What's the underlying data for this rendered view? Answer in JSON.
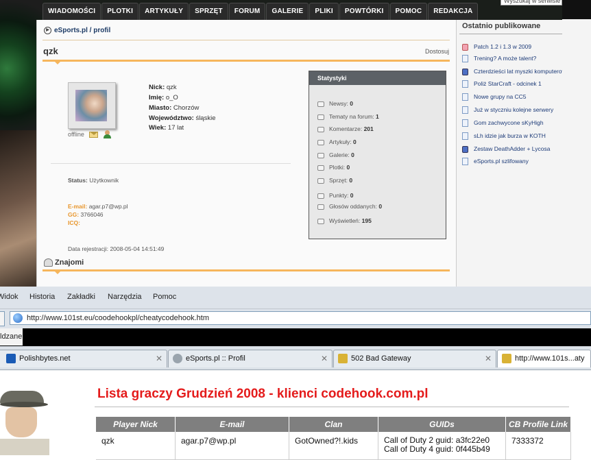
{
  "esports": {
    "nav_tabs": [
      "WIADOMOŚCI",
      "PLOTKI",
      "ARTYKUŁY",
      "SPRZĘT",
      "FORUM",
      "GALERIE",
      "PLIKI",
      "POWTÓRKI",
      "POMOC",
      "REDAKCJA"
    ],
    "search_placeholder": "Wyszukaj w serwisie",
    "breadcrumb": "eSports.pl / profil",
    "profile_title": "qzk",
    "customize_link": "Dostosuj",
    "offline": "offline",
    "fields": {
      "nick_label": "Nick:",
      "nick": "qzk",
      "imie_label": "Imię:",
      "imie": "o_O",
      "miasto_label": "Miasto:",
      "miasto": "Chorzów",
      "woj_label": "Województwo:",
      "woj": "śląskie",
      "wiek_label": "Wiek:",
      "wiek": "17 lat"
    },
    "status_label": "Status:",
    "status": "Użytkownik",
    "email_label": "E-mail:",
    "email": "agar.p7@wp.pl",
    "gg_label": "GG:",
    "gg": "3766046",
    "icq_label": "ICQ:",
    "reg_label": "Data rejestracji:",
    "reg_date": "2008-05-04 14:51:49",
    "friends": "Znajomi",
    "stats_title": "Statystyki",
    "stats": [
      {
        "label": "Newsy:",
        "value": "0"
      },
      {
        "label": "Tematy na forum:",
        "value": "1"
      },
      {
        "label": "Komentarze:",
        "value": "201"
      },
      {
        "label": "Artykuły:",
        "value": "0"
      },
      {
        "label": "Galerie:",
        "value": "0"
      },
      {
        "label": "Plotki:",
        "value": "0"
      },
      {
        "label": "Sprzęt:",
        "value": "0"
      },
      {
        "label": "Punkty:",
        "value": "0"
      },
      {
        "label": "Głosów oddanych:",
        "value": "0"
      },
      {
        "label": "Wyświetleń:",
        "value": "195"
      }
    ],
    "sidebar_title": "Ostatnio publikowane",
    "sidebar_items": [
      {
        "text": "Patch 1.2 i 1.3 w 2009",
        "icon": "red"
      },
      {
        "text": "Trening? A może talent?",
        "icon": "doc"
      },
      {
        "text": "Czterdzieści lat myszki komputerowej",
        "icon": "blue"
      },
      {
        "text": "Poliż StarCraft - odcinek 1",
        "icon": "doc"
      },
      {
        "text": "Nowe grupy na CC5",
        "icon": "doc"
      },
      {
        "text": "Już w styczniu kolejne serwery",
        "icon": "doc"
      },
      {
        "text": "Gom zachwycone sKyHigh",
        "icon": "doc"
      },
      {
        "text": "sLh idzie jak burza w KOTH",
        "icon": "doc"
      },
      {
        "text": "Zestaw DeathAdder + Lycosa",
        "icon": "blue"
      },
      {
        "text": "eSports.pl szlifowany",
        "icon": "doc"
      }
    ]
  },
  "browser": {
    "menu": [
      "Widok",
      "Historia",
      "Zakładki",
      "Narzędzia",
      "Pomoc"
    ],
    "url": "http://www.101st.eu/coodehookpl/cheatycodehook.htm",
    "bookmark_label": "ldzane",
    "tabs": [
      {
        "title": "Polishbytes.net",
        "fav_color": "#1a5bb5"
      },
      {
        "title": "eSports.pl :: Profil",
        "fav_color": "#9aa4ad"
      },
      {
        "title": "502 Bad Gateway",
        "fav_color": "#d9b235"
      },
      {
        "title": "http://www.101s...aty",
        "fav_color": "#d9b235"
      }
    ]
  },
  "page2": {
    "heading": "Lista graczy Grudzień 2008 - klienci codehook.com.pl",
    "columns": [
      "Player Nick",
      "E-mail",
      "Clan",
      "GUIDs",
      "CB Profile Link"
    ],
    "rows": [
      {
        "nick": "qzk",
        "email": "agar.p7@wp.pl",
        "clan": "GotOwned?!.kids",
        "guid1": "Call of Duty 2 guid: a3fc22e0",
        "guid2": "Call of Duty 4 guid: 0f445b49",
        "cb": "7333372"
      }
    ]
  },
  "colors": {
    "accent_orange": "#f6b65c",
    "heading_red": "#e41b1b",
    "nav_dark": "#2a2a2a"
  }
}
